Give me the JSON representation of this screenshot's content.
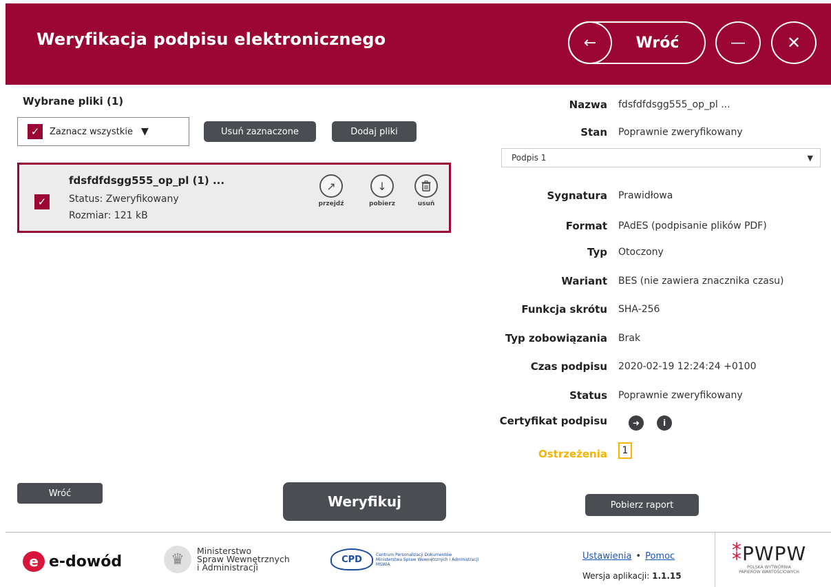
{
  "header": {
    "title": "Weryfikacja podpisu elektronicznego",
    "back_label": "Wróć",
    "back_icon": "←",
    "minimize_icon": "—",
    "close_icon": "✕"
  },
  "files_panel": {
    "title": "Wybrane pliki (1)",
    "select_all_label": "Zaznacz wszystkie",
    "remove_selected_label": "Usuń zaznaczone",
    "add_files_label": "Dodaj pliki",
    "file": {
      "name": "fdsfdfdsgg555_op_pl (1) ...",
      "status": "Status: Zweryfikowany",
      "size": "Rozmiar: 121 kB",
      "actions": {
        "go": "przejdź",
        "download": "pobierz",
        "delete": "usuń"
      }
    }
  },
  "details": {
    "name_label": "Nazwa",
    "name_value": "fdsfdfdsgg555_op_pl ...",
    "state_label": "Stan",
    "state_value": "Poprawnie zweryfikowany",
    "signature_select": "Podpis 1",
    "rows": [
      {
        "label": "Sygnatura",
        "value": "Prawidłowa"
      },
      {
        "label": "Format",
        "value": "PAdES (podpisanie plików PDF)"
      },
      {
        "label": "Typ",
        "value": "Otoczony"
      },
      {
        "label": "Wariant",
        "value": "BES (nie zawiera znacznika czasu)"
      },
      {
        "label": "Funkcja skrótu",
        "value": "SHA-256"
      },
      {
        "label": "Typ zobowiązania",
        "value": "Brak"
      },
      {
        "label": "Czas podpisu",
        "value": "2020-02-19 12:24:24 +0100"
      },
      {
        "label": "Status",
        "value": "Poprawnie zweryfikowany"
      }
    ],
    "certificate_label": "Certyfikat podpisu",
    "warnings_label": "Ostrzeżenia",
    "warnings_count": "1"
  },
  "buttons": {
    "back": "Wróć",
    "verify": "Weryfikuj",
    "download_report": "Pobierz raport"
  },
  "footer": {
    "edowod": "e-dowód",
    "ministry_line1": "Ministerstwo",
    "ministry_line2": "Spraw Wewnętrznych",
    "ministry_line3": "i Administracji",
    "cpd_mark": "CPD",
    "cpd_line1": "Centrum Personalizacji Dokumentów",
    "cpd_line2": "Ministerstwa Spraw Wewnętrznych i Administracji",
    "cpd_line3": "MSWiA",
    "settings_link": "Ustawienia",
    "help_link": "Pomoc",
    "version_label": "Wersja aplikacji:",
    "version_value": "1.1.15",
    "pwpw": "PWPW",
    "pwpw_sub1": "POLSKA WYTWÓRNIA",
    "pwpw_sub2": "PAPIERÓW WARTOŚCIOWYCH"
  },
  "colors": {
    "brand": "#9b0634",
    "dark_button": "#4a4d52",
    "warning": "#f5b400"
  }
}
